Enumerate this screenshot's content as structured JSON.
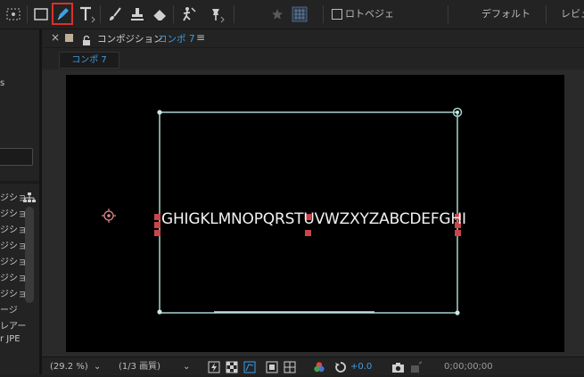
{
  "toolbar": {
    "workspace_default": "デフォルト",
    "workspace_review": "レビュ",
    "rotobrush_label": "ロトベジェ"
  },
  "left_panel": {
    "top_fragment": "s",
    "items": [
      "ジショ",
      "ジショ",
      "ジショ",
      "ジショ",
      "ジショ",
      "ジショ",
      "ジショ",
      "ージ",
      "レアー",
      "r JPE"
    ]
  },
  "composition": {
    "close_symbol": "×",
    "title_prefix": "コンポジション",
    "comp_name": "コンポ 7",
    "menu_symbol": "≡",
    "tab_label": "コンポ 7"
  },
  "canvas": {
    "text_layer": "GHIGKLMNOPQRSTUVWZXYZABCDEFGHI"
  },
  "bottom_bar": {
    "zoom": "(29.2 %)",
    "resolution": "(1/3 画質)",
    "exposure": "+0.0",
    "timecode": "0;00;00;00"
  },
  "colors": {
    "active_tool_border": "#d9312d",
    "pen_tool_blue": "#3b9fe8",
    "bbox_line": "#a9d3cf",
    "text_handle": "#c9454a",
    "link_blue": "#3f9de3"
  },
  "icons": [
    "selection-marquee-icon",
    "rectangle-icon",
    "pen-icon",
    "type-icon",
    "brush-icon",
    "clone-stamp-icon",
    "eraser-icon",
    "roto-brush-icon",
    "puppet-pin-icon",
    "star-icon",
    "snap-grid-icon",
    "lock-icon",
    "flowchart-icon",
    "anchor-point-icon",
    "fast-preview-icon",
    "transparency-grid-icon",
    "mask-path-icon",
    "region-icon",
    "guides-icon",
    "color-channel-icon",
    "reset-exposure-icon",
    "camera-icon"
  ]
}
